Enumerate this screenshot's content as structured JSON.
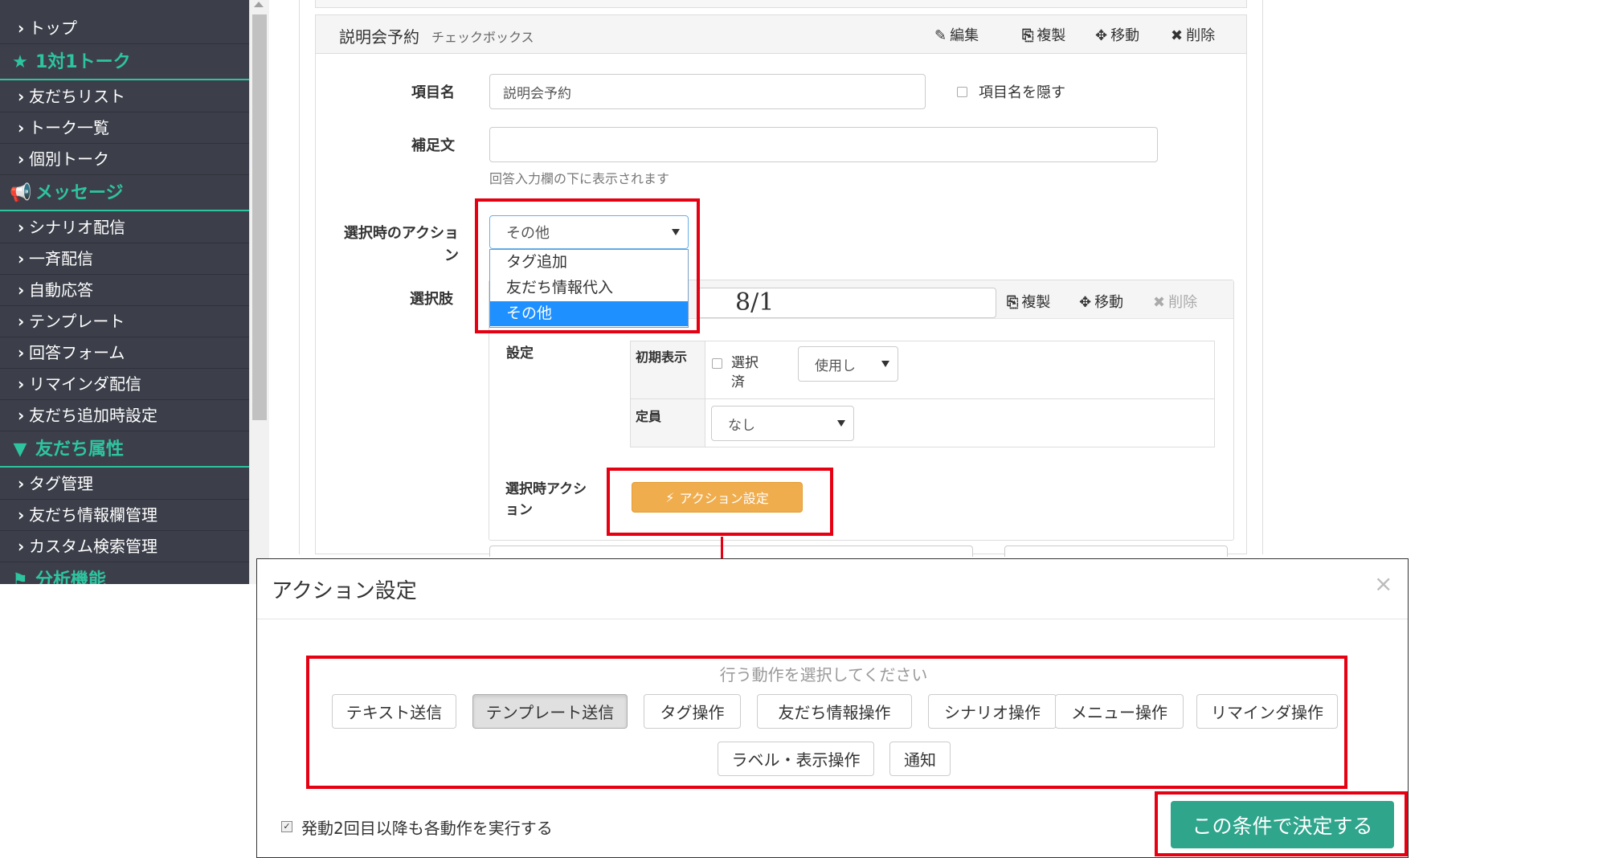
{
  "sidebar": {
    "items": [
      {
        "type": "link",
        "label": "トップ"
      },
      {
        "type": "header",
        "label": "1対1トーク",
        "icon": "star-icon"
      },
      {
        "type": "link",
        "label": "友だちリスト"
      },
      {
        "type": "link",
        "label": "トーク一覧"
      },
      {
        "type": "link",
        "label": "個別トーク"
      },
      {
        "type": "header",
        "label": "メッセージ",
        "icon": "megaphone-icon"
      },
      {
        "type": "link",
        "label": "シナリオ配信"
      },
      {
        "type": "link",
        "label": "一斉配信"
      },
      {
        "type": "link",
        "label": "自動応答"
      },
      {
        "type": "link",
        "label": "テンプレート"
      },
      {
        "type": "link",
        "label": "回答フォーム"
      },
      {
        "type": "link",
        "label": "リマインダ配信"
      },
      {
        "type": "link",
        "label": "友だち追加時設定"
      },
      {
        "type": "header",
        "label": "友だち属性",
        "icon": "filter-icon"
      },
      {
        "type": "link",
        "label": "タグ管理"
      },
      {
        "type": "link",
        "label": "友だち情報欄管理"
      },
      {
        "type": "link",
        "label": "カスタム検索管理"
      },
      {
        "type": "header",
        "label": "分析機能",
        "icon": "flag-icon"
      }
    ],
    "accent_color": "#2ec4a0",
    "bg_color": "#3c3f4a"
  },
  "form": {
    "title": "説明会予約",
    "subtitle": "チェックボックス",
    "toolbar": {
      "edit": "編集",
      "copy": "複製",
      "move": "移動",
      "delete": "削除"
    },
    "item_name_label": "項目名",
    "item_name_value": "説明会予約",
    "hide_name_label": "項目名を隠す",
    "supplement_label": "補足文",
    "supplement_value": "",
    "supplement_help": "回答入力欄の下に表示されます",
    "action_label": "選択時のアクション",
    "action_selected": "その他",
    "action_options": [
      "タグ追加",
      "友だち情報代入",
      "その他"
    ],
    "choices_label": "選択肢"
  },
  "choice": {
    "value": "8/1",
    "toolbar": {
      "copy": "複製",
      "move": "移動",
      "delete": "削除"
    },
    "settings_label": "設定",
    "initial_display_label": "初期表示",
    "selected_label": "選択済",
    "use_select_value": "使用し",
    "capacity_label": "定員",
    "capacity_value": "なし",
    "on_select_action_label": "選択時アクション",
    "action_settings_button": "アクション設定"
  },
  "modal": {
    "title": "アクション設定",
    "close": "×",
    "hint": "行う動作を選択してください",
    "actions": [
      "テキスト送信",
      "テンプレート送信",
      "タグ操作",
      "友だち情報操作",
      "シナリオ操作",
      "メニュー操作",
      "リマインダ操作",
      "ラベル・表示操作",
      "通知"
    ],
    "active_action": "テンプレート送信",
    "repeat_checkbox_label": "発動2回目以降も各動作を実行する",
    "repeat_checked": true,
    "confirm_button": "この条件で決定する",
    "confirm_color": "#2fa58c"
  },
  "highlight_color": "#e60012"
}
